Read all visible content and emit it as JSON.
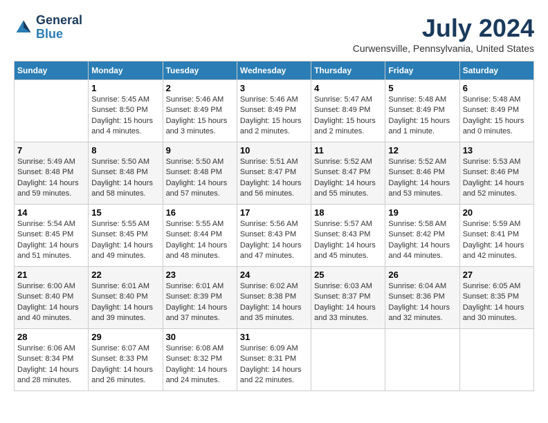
{
  "header": {
    "logo": {
      "general": "General",
      "blue": "Blue"
    },
    "month_year": "July 2024",
    "location": "Curwensville, Pennsylvania, United States"
  },
  "weekdays": [
    "Sunday",
    "Monday",
    "Tuesday",
    "Wednesday",
    "Thursday",
    "Friday",
    "Saturday"
  ],
  "weeks": [
    [
      {
        "day": null,
        "info": null
      },
      {
        "day": "1",
        "sunrise": "5:45 AM",
        "sunset": "8:50 PM",
        "daylight": "15 hours and 4 minutes."
      },
      {
        "day": "2",
        "sunrise": "5:46 AM",
        "sunset": "8:49 PM",
        "daylight": "15 hours and 3 minutes."
      },
      {
        "day": "3",
        "sunrise": "5:46 AM",
        "sunset": "8:49 PM",
        "daylight": "15 hours and 2 minutes."
      },
      {
        "day": "4",
        "sunrise": "5:47 AM",
        "sunset": "8:49 PM",
        "daylight": "15 hours and 2 minutes."
      },
      {
        "day": "5",
        "sunrise": "5:48 AM",
        "sunset": "8:49 PM",
        "daylight": "15 hours and 1 minute."
      },
      {
        "day": "6",
        "sunrise": "5:48 AM",
        "sunset": "8:49 PM",
        "daylight": "15 hours and 0 minutes."
      }
    ],
    [
      {
        "day": "7",
        "sunrise": "5:49 AM",
        "sunset": "8:48 PM",
        "daylight": "14 hours and 59 minutes."
      },
      {
        "day": "8",
        "sunrise": "5:50 AM",
        "sunset": "8:48 PM",
        "daylight": "14 hours and 58 minutes."
      },
      {
        "day": "9",
        "sunrise": "5:50 AM",
        "sunset": "8:48 PM",
        "daylight": "14 hours and 57 minutes."
      },
      {
        "day": "10",
        "sunrise": "5:51 AM",
        "sunset": "8:47 PM",
        "daylight": "14 hours and 56 minutes."
      },
      {
        "day": "11",
        "sunrise": "5:52 AM",
        "sunset": "8:47 PM",
        "daylight": "14 hours and 55 minutes."
      },
      {
        "day": "12",
        "sunrise": "5:52 AM",
        "sunset": "8:46 PM",
        "daylight": "14 hours and 53 minutes."
      },
      {
        "day": "13",
        "sunrise": "5:53 AM",
        "sunset": "8:46 PM",
        "daylight": "14 hours and 52 minutes."
      }
    ],
    [
      {
        "day": "14",
        "sunrise": "5:54 AM",
        "sunset": "8:45 PM",
        "daylight": "14 hours and 51 minutes."
      },
      {
        "day": "15",
        "sunrise": "5:55 AM",
        "sunset": "8:45 PM",
        "daylight": "14 hours and 49 minutes."
      },
      {
        "day": "16",
        "sunrise": "5:55 AM",
        "sunset": "8:44 PM",
        "daylight": "14 hours and 48 minutes."
      },
      {
        "day": "17",
        "sunrise": "5:56 AM",
        "sunset": "8:43 PM",
        "daylight": "14 hours and 47 minutes."
      },
      {
        "day": "18",
        "sunrise": "5:57 AM",
        "sunset": "8:43 PM",
        "daylight": "14 hours and 45 minutes."
      },
      {
        "day": "19",
        "sunrise": "5:58 AM",
        "sunset": "8:42 PM",
        "daylight": "14 hours and 44 minutes."
      },
      {
        "day": "20",
        "sunrise": "5:59 AM",
        "sunset": "8:41 PM",
        "daylight": "14 hours and 42 minutes."
      }
    ],
    [
      {
        "day": "21",
        "sunrise": "6:00 AM",
        "sunset": "8:40 PM",
        "daylight": "14 hours and 40 minutes."
      },
      {
        "day": "22",
        "sunrise": "6:01 AM",
        "sunset": "8:40 PM",
        "daylight": "14 hours and 39 minutes."
      },
      {
        "day": "23",
        "sunrise": "6:01 AM",
        "sunset": "8:39 PM",
        "daylight": "14 hours and 37 minutes."
      },
      {
        "day": "24",
        "sunrise": "6:02 AM",
        "sunset": "8:38 PM",
        "daylight": "14 hours and 35 minutes."
      },
      {
        "day": "25",
        "sunrise": "6:03 AM",
        "sunset": "8:37 PM",
        "daylight": "14 hours and 33 minutes."
      },
      {
        "day": "26",
        "sunrise": "6:04 AM",
        "sunset": "8:36 PM",
        "daylight": "14 hours and 32 minutes."
      },
      {
        "day": "27",
        "sunrise": "6:05 AM",
        "sunset": "8:35 PM",
        "daylight": "14 hours and 30 minutes."
      }
    ],
    [
      {
        "day": "28",
        "sunrise": "6:06 AM",
        "sunset": "8:34 PM",
        "daylight": "14 hours and 28 minutes."
      },
      {
        "day": "29",
        "sunrise": "6:07 AM",
        "sunset": "8:33 PM",
        "daylight": "14 hours and 26 minutes."
      },
      {
        "day": "30",
        "sunrise": "6:08 AM",
        "sunset": "8:32 PM",
        "daylight": "14 hours and 24 minutes."
      },
      {
        "day": "31",
        "sunrise": "6:09 AM",
        "sunset": "8:31 PM",
        "daylight": "14 hours and 22 minutes."
      },
      {
        "day": null,
        "info": null
      },
      {
        "day": null,
        "info": null
      },
      {
        "day": null,
        "info": null
      }
    ]
  ]
}
